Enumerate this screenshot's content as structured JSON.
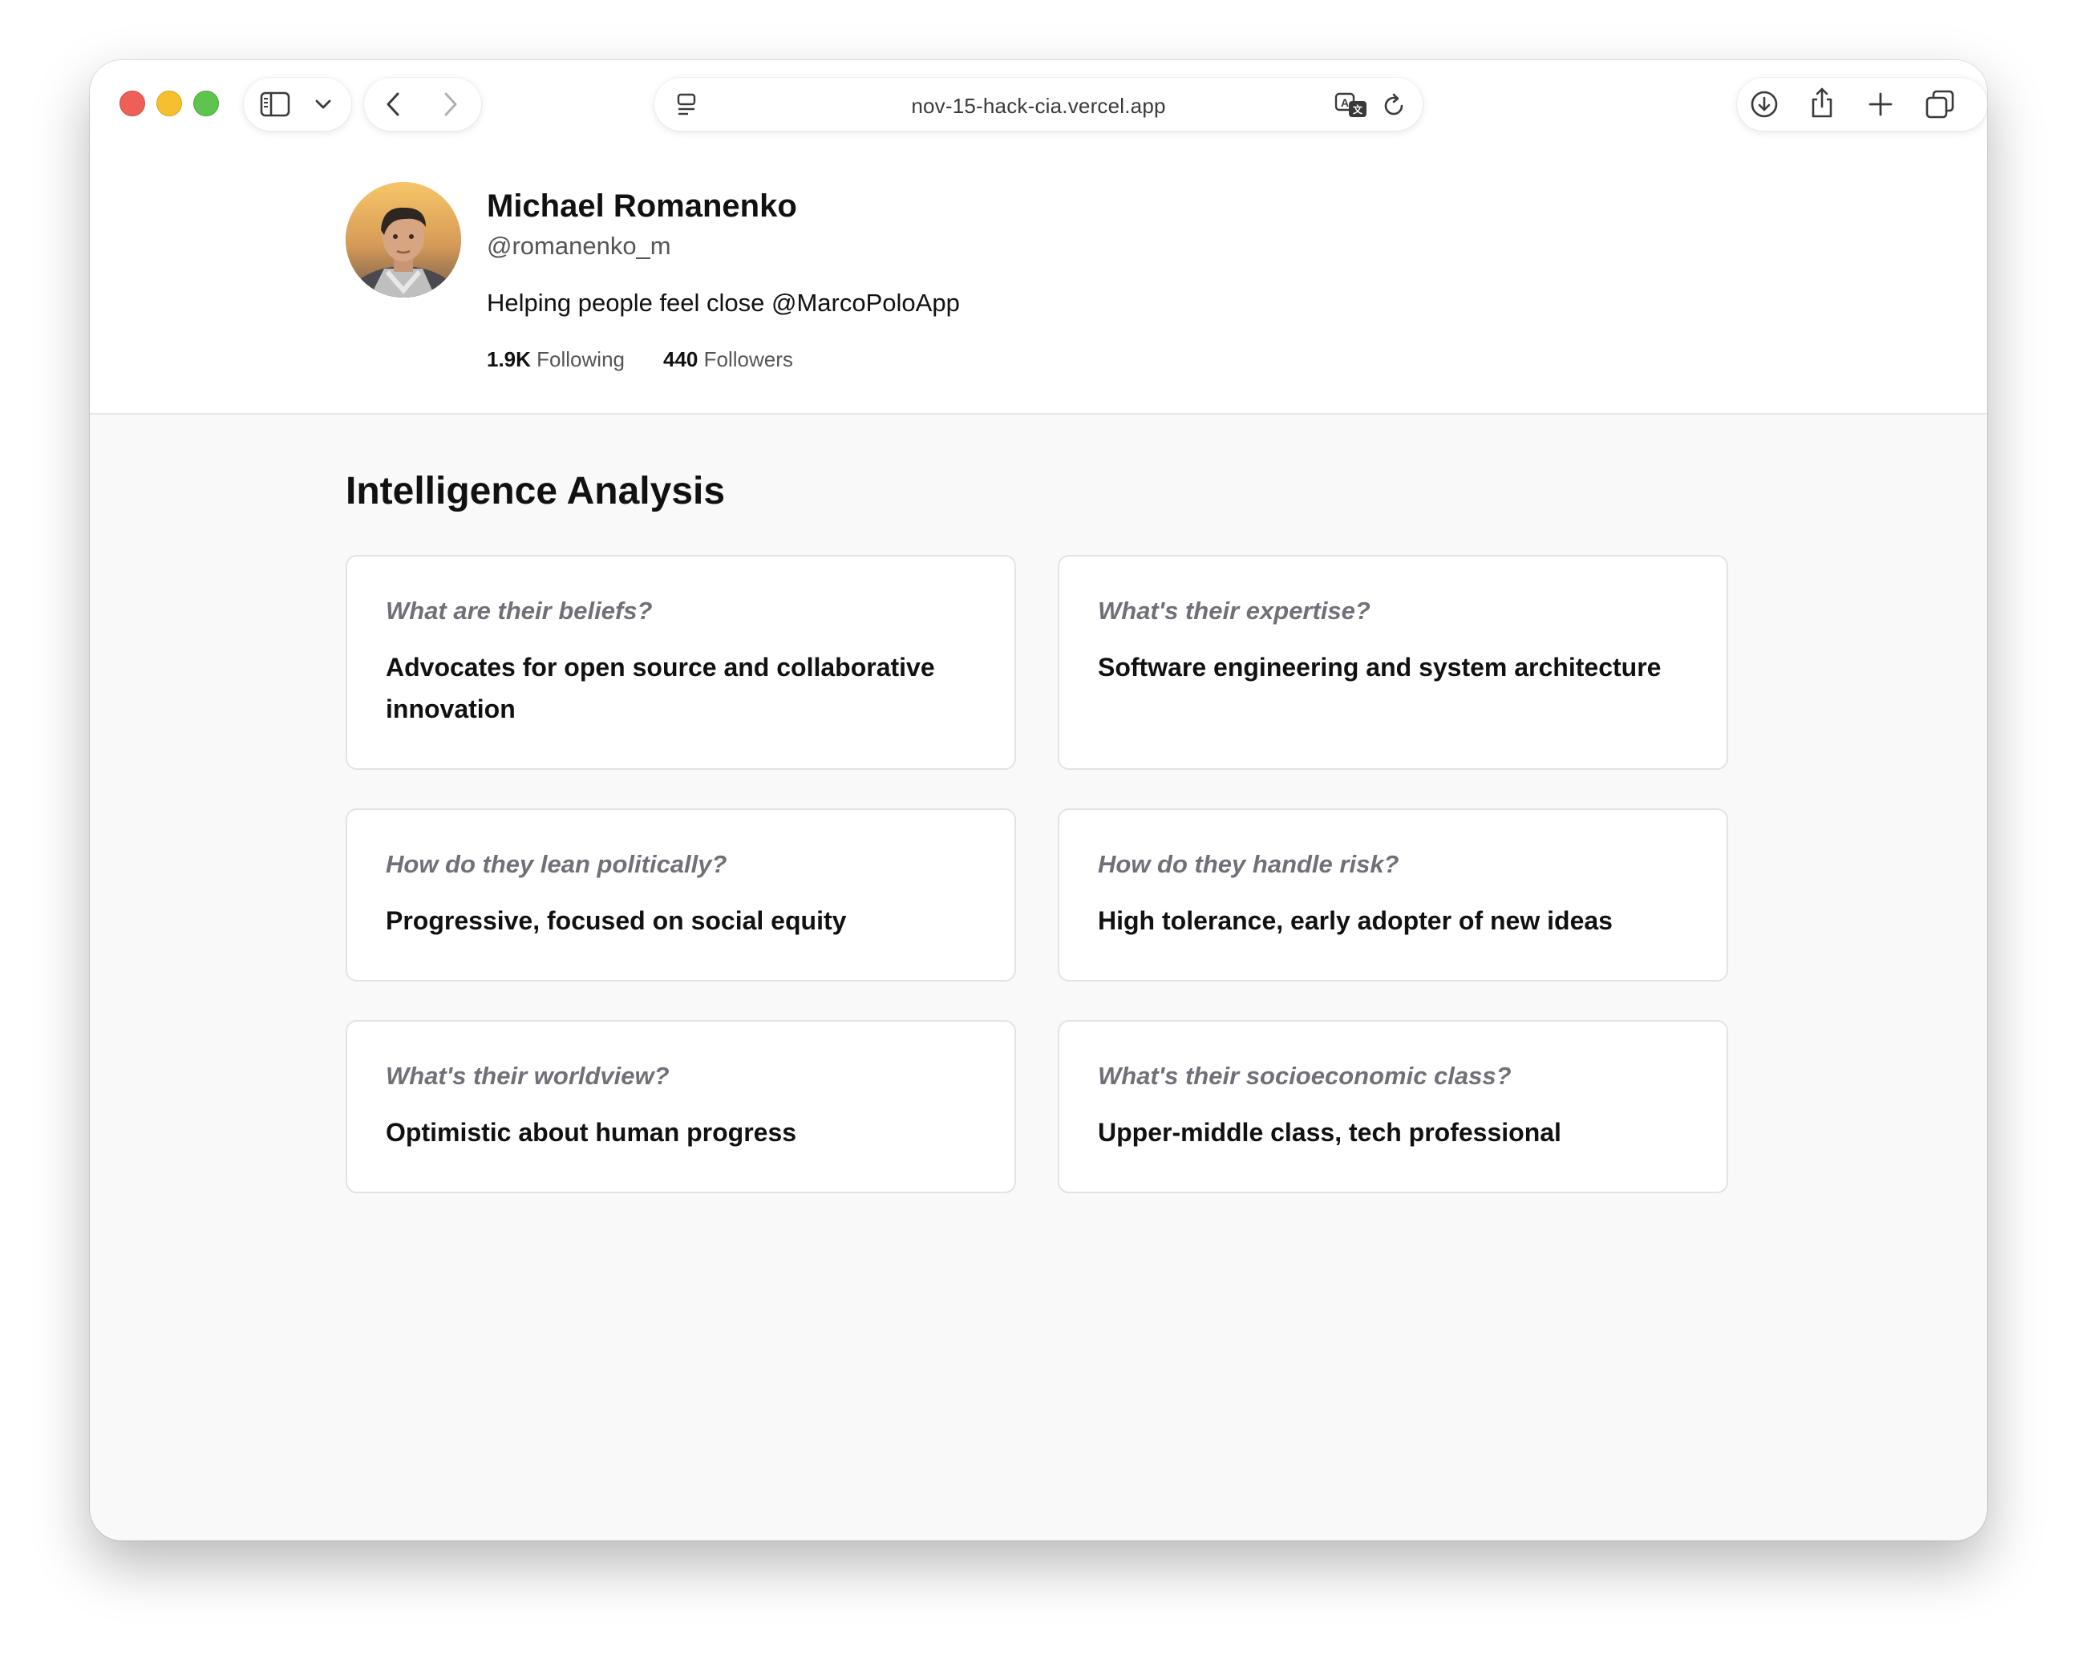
{
  "browser": {
    "url": "nov-15-hack-cia.vercel.app"
  },
  "profile": {
    "name": "Michael Romanenko",
    "handle": "@romanenko_m",
    "bio": "Helping people feel close @MarcoPoloApp",
    "following_count": "1.9K",
    "following_label": "Following",
    "followers_count": "440",
    "followers_label": "Followers"
  },
  "analysis": {
    "title": "Intelligence Analysis",
    "cards": [
      {
        "question": "What are their beliefs?",
        "answer": "Advocates for open source and collaborative innovation"
      },
      {
        "question": "What's their expertise?",
        "answer": "Software engineering and system architecture"
      },
      {
        "question": "How do they lean politically?",
        "answer": "Progressive, focused on social equity"
      },
      {
        "question": "How do they handle risk?",
        "answer": "High tolerance, early adopter of new ideas"
      },
      {
        "question": "What's their worldview?",
        "answer": "Optimistic about human progress"
      },
      {
        "question": "What's their socioeconomic class?",
        "answer": "Upper-middle class, tech professional"
      }
    ]
  }
}
